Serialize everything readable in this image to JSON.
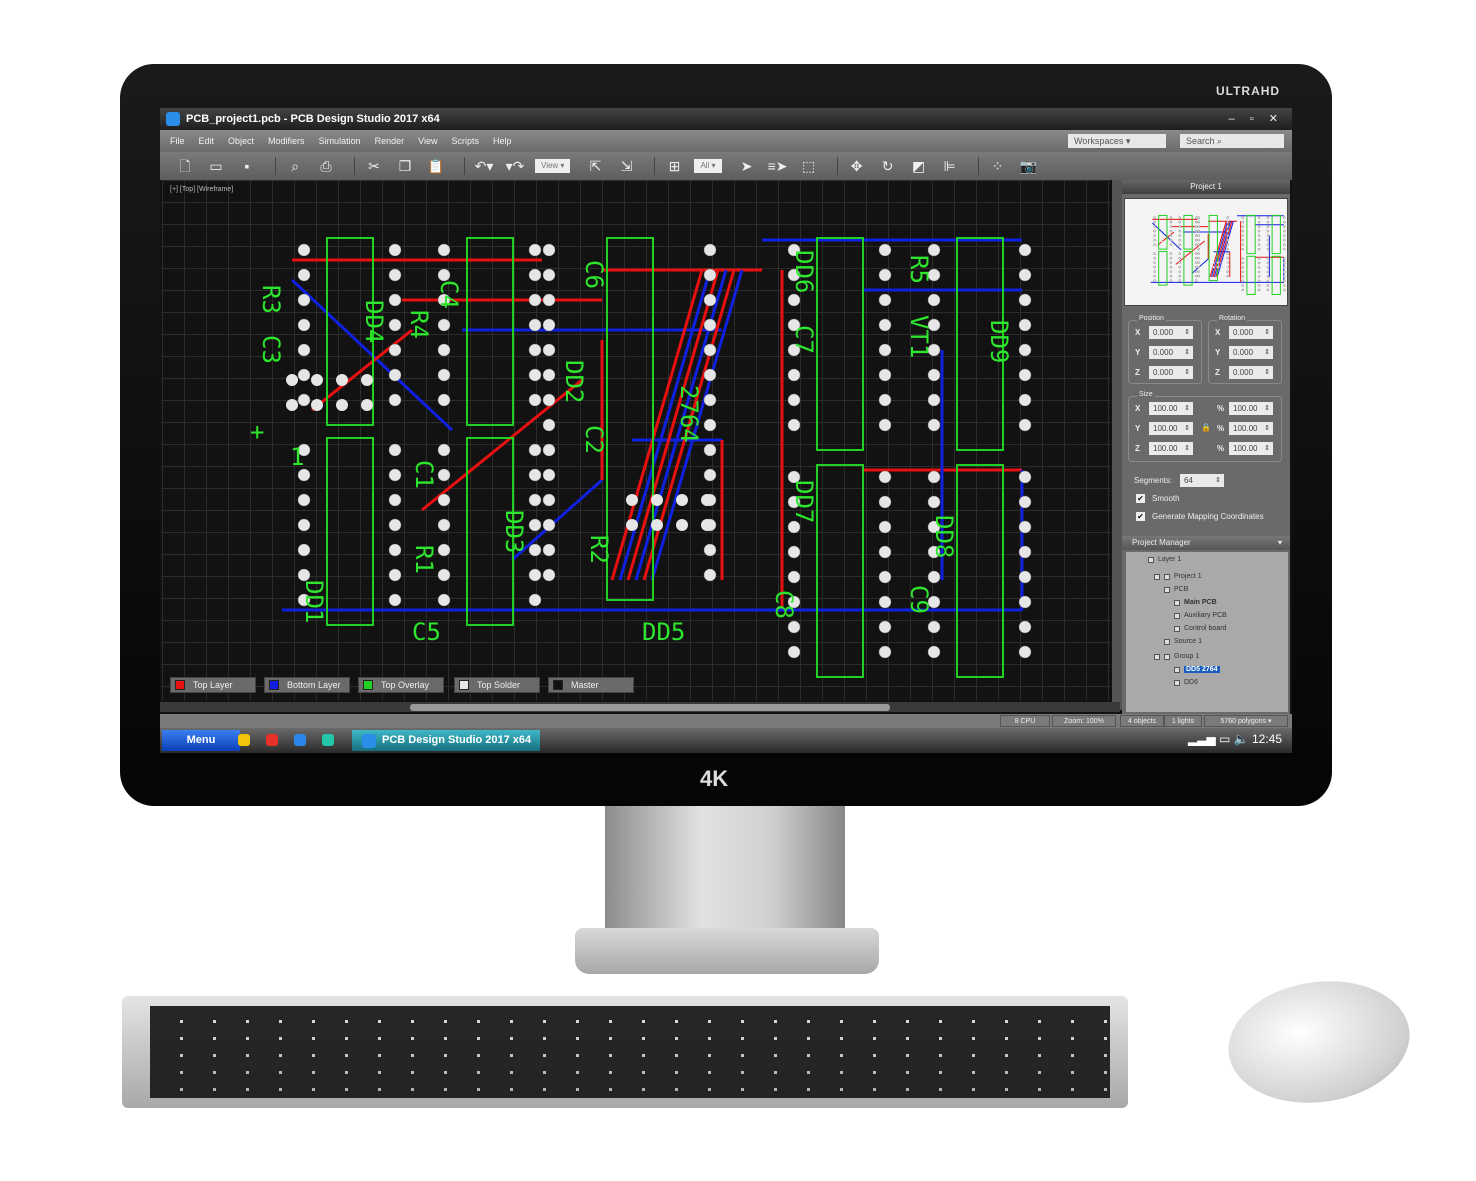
{
  "monitor": {
    "brand": "ULTRAHD",
    "badge": "4K"
  },
  "window": {
    "title": "PCB_project1.pcb - PCB Design Studio 2017 x64",
    "controls": "– ▫ ✕"
  },
  "menu": [
    "File",
    "Edit",
    "Object",
    "Modifiers",
    "Simulation",
    "Render",
    "View",
    "Scripts",
    "Help"
  ],
  "header": {
    "workspaces": "Workspaces ▾",
    "search": "Search ⌕"
  },
  "toolbar": {
    "view_dropdown": "View ▾",
    "filter_dropdown": "All ▾"
  },
  "viewport": {
    "label": "[+] [Top] [Wireframe]"
  },
  "pcb_labels": [
    "R3",
    "C3",
    "DD4",
    "R4",
    "C4",
    "C6",
    "DD2",
    "C2",
    "2764",
    "DD6",
    "C7",
    "R5",
    "VT1",
    "DD9",
    "DD3",
    "R2",
    "C1",
    "R1",
    "DD1",
    "C5",
    "DD5",
    "DD7",
    "C8",
    "DD8",
    "C9",
    "1",
    "+"
  ],
  "layers": [
    {
      "label": "Top Layer",
      "color": "#e81010"
    },
    {
      "label": "Bottom Layer",
      "color": "#1020e0"
    },
    {
      "label": "Top Overlay",
      "color": "#22d022"
    },
    {
      "label": "Top Solder",
      "color": "#e8e8e8"
    },
    {
      "label": "Master",
      "color": "#111111"
    }
  ],
  "panel": {
    "title": "Project 1",
    "position": {
      "label": "Position",
      "x": "0.000",
      "y": "0.000",
      "z": "0.000"
    },
    "rotation": {
      "label": "Rotation",
      "x": "0.000",
      "y": "0.000",
      "z": "0.000"
    },
    "size": {
      "label": "Size",
      "x": "100.00",
      "y": "100.00",
      "z": "100.00",
      "px": "100.00",
      "py": "100.00",
      "pz": "100.00",
      "pct": "%"
    },
    "segments_label": "Segments:",
    "segments": "64",
    "smooth": {
      "label": "Smooth",
      "checked": true
    },
    "mapping": {
      "label": "Generate Mapping Coordinates",
      "checked": true
    }
  },
  "project_manager": {
    "title": "Project Manager",
    "items": [
      "Layer 1",
      "Project 1",
      "PCB",
      "Main PCB",
      "Auxiliary PCB",
      "Control board",
      "Source 1",
      "Group 1",
      "DD5 2764",
      "DD6"
    ],
    "selected": "DD5 2764"
  },
  "status": {
    "cpu": "8 CPU",
    "zoom": "Zoom: 100%",
    "objects": "4 objects",
    "lights": "1 lights",
    "polygons": "5760 polygons ▾"
  },
  "taskbar": {
    "menu": "Menu",
    "app": "PCB Design Studio 2017 x64",
    "clock": "12:45",
    "quick_colors": [
      "#f2c40c",
      "#e8302a",
      "#2a86e8",
      "#22c8a8"
    ]
  }
}
